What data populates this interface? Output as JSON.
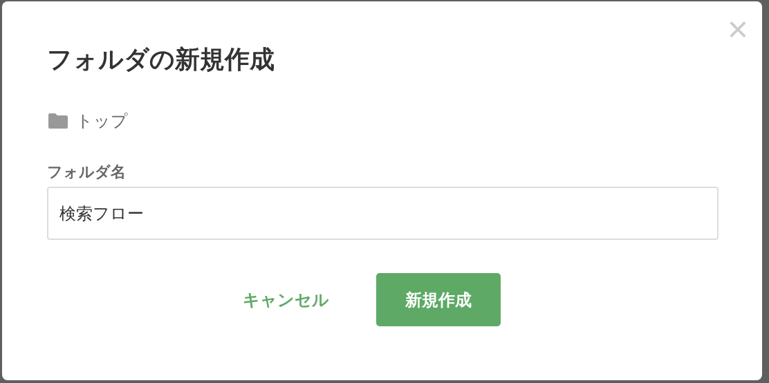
{
  "dialog": {
    "title": "フォルダの新規作成",
    "close_label": "×",
    "breadcrumb": "トップ",
    "field": {
      "label": "フォルダ名",
      "value": "検索フロー"
    },
    "buttons": [
      {
        "label": "キャンセル",
        "kind": "secondary"
      },
      {
        "label": "新規作成",
        "kind": "primary"
      }
    ]
  }
}
